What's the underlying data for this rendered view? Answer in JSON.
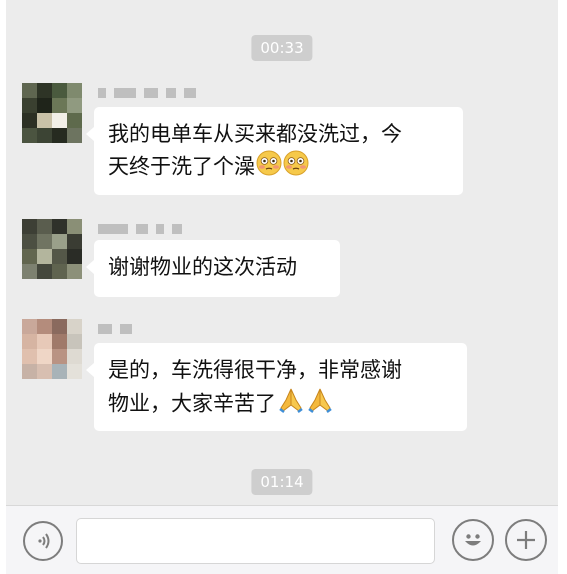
{
  "chat": {
    "timestamps": [
      "00:33",
      "01:14"
    ],
    "messages": [
      {
        "lines": [
          "我的电单车从买来都没洗过，今",
          "天终于洗了个澡"
        ],
        "emoji": [
          "flushed-face-emoji",
          "flushed-face-emoji"
        ]
      },
      {
        "lines": [
          "谢谢物业的这次活动"
        ],
        "emoji": []
      },
      {
        "lines": [
          "是的，车洗得很干净，非常感谢",
          "物业，大家辛苦了"
        ],
        "emoji": [
          "folded-hands-emoji",
          "folded-hands-emoji"
        ]
      }
    ]
  },
  "input_bar": {
    "voice_icon": "voice-input-icon",
    "emoji_icon": "emoji-smile-icon",
    "more_icon": "plus-more-icon",
    "message_field_value": ""
  },
  "colors": {
    "chat_background": "#ececec",
    "bubble": "#ffffff",
    "timestamp_pill": "#cecece",
    "icon_stroke": "#7d7d7d"
  }
}
